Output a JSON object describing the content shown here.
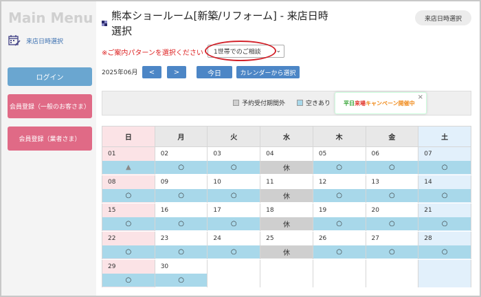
{
  "sidebar": {
    "title": "Main Menu",
    "link_label": "来店日時選択",
    "login_label": "ログイン",
    "member_general_label": "会員登録（一般のお客さま）",
    "member_business_label": "会員登録（業者さま）"
  },
  "header": {
    "title": "熊本ショールーム[新築/リフォーム] - 来店日時選択",
    "top_right_button": "来店日時選択"
  },
  "pattern": {
    "label": "※ご案内パターンを選択ください",
    "selected": "1世帯でのご相談"
  },
  "nav": {
    "month": "2025年06月",
    "prev": "<",
    "next": ">",
    "today": "今日",
    "from_calendar": "カレンダーから選択"
  },
  "legend": {
    "outside_period": "予約受付期間外",
    "available": "空きあり"
  },
  "campaign": {
    "part1": "平日",
    "part2": "来場",
    "part3": "キャンペーン開催中",
    "close": "×"
  },
  "calendar": {
    "weekdays": [
      "日",
      "月",
      "火",
      "水",
      "木",
      "金",
      "土"
    ],
    "weeks": [
      [
        {
          "day": "01",
          "mark": "▲",
          "type": "limited"
        },
        {
          "day": "02",
          "mark": "○",
          "type": "open"
        },
        {
          "day": "03",
          "mark": "○",
          "type": "open"
        },
        {
          "day": "04",
          "mark": "休",
          "type": "closed"
        },
        {
          "day": "05",
          "mark": "○",
          "type": "open"
        },
        {
          "day": "06",
          "mark": "○",
          "type": "open"
        },
        {
          "day": "07",
          "mark": "○",
          "type": "open"
        }
      ],
      [
        {
          "day": "08",
          "mark": "○",
          "type": "open"
        },
        {
          "day": "09",
          "mark": "○",
          "type": "open"
        },
        {
          "day": "10",
          "mark": "○",
          "type": "open"
        },
        {
          "day": "11",
          "mark": "休",
          "type": "closed"
        },
        {
          "day": "12",
          "mark": "○",
          "type": "open"
        },
        {
          "day": "13",
          "mark": "○",
          "type": "open"
        },
        {
          "day": "14",
          "mark": "○",
          "type": "open"
        }
      ],
      [
        {
          "day": "15",
          "mark": "○",
          "type": "open"
        },
        {
          "day": "16",
          "mark": "○",
          "type": "open"
        },
        {
          "day": "17",
          "mark": "○",
          "type": "open"
        },
        {
          "day": "18",
          "mark": "休",
          "type": "closed"
        },
        {
          "day": "19",
          "mark": "○",
          "type": "open"
        },
        {
          "day": "20",
          "mark": "○",
          "type": "open"
        },
        {
          "day": "21",
          "mark": "○",
          "type": "open"
        }
      ],
      [
        {
          "day": "22",
          "mark": "○",
          "type": "open"
        },
        {
          "day": "23",
          "mark": "○",
          "type": "open"
        },
        {
          "day": "24",
          "mark": "○",
          "type": "open"
        },
        {
          "day": "25",
          "mark": "休",
          "type": "closed"
        },
        {
          "day": "26",
          "mark": "○",
          "type": "open"
        },
        {
          "day": "27",
          "mark": "○",
          "type": "open"
        },
        {
          "day": "28",
          "mark": "○",
          "type": "open"
        }
      ],
      [
        {
          "day": "29",
          "mark": "○",
          "type": "open"
        },
        {
          "day": "30",
          "mark": "○",
          "type": "open"
        },
        null,
        null,
        null,
        null,
        null
      ]
    ]
  },
  "colors": {
    "available": "#a8d8ea",
    "closed": "#cfcfcf",
    "sunday": "#fbe3e6",
    "saturday": "#e2f0fb",
    "nav_button": "#4c86c6",
    "login_button": "#6aa6d0",
    "member_button": "#e06a86",
    "alert_text": "#dd2222"
  }
}
